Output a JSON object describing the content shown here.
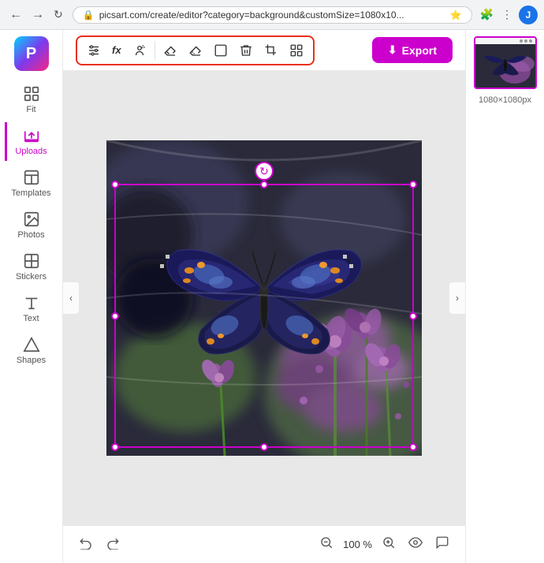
{
  "browser": {
    "url": "picsart.com/create/editor?category=background&customSize=1080x10...",
    "back_label": "←",
    "forward_label": "→",
    "refresh_label": "↻",
    "avatar_label": "J"
  },
  "toolbar": {
    "export_label": "Export",
    "export_icon": "⬇",
    "tools": [
      {
        "id": "adjustments",
        "icon": "⊞",
        "label": "adjustments"
      },
      {
        "id": "fx",
        "icon": "fx",
        "label": "fx"
      },
      {
        "id": "person",
        "icon": "👤",
        "label": "person-cutout"
      }
    ],
    "edit_tools": [
      {
        "id": "eraser",
        "icon": "◻",
        "label": "eraser"
      },
      {
        "id": "eraser2",
        "icon": "⬜",
        "label": "background-eraser"
      },
      {
        "id": "rect",
        "icon": "▭",
        "label": "frame"
      },
      {
        "id": "trash",
        "icon": "🗑",
        "label": "delete"
      },
      {
        "id": "crop",
        "icon": "⛶",
        "label": "crop"
      },
      {
        "id": "more",
        "icon": "•••",
        "label": "more-options"
      }
    ]
  },
  "sidebar": {
    "logo": "P",
    "items": [
      {
        "id": "fit",
        "icon": "fit",
        "label": "Fit"
      },
      {
        "id": "uploads",
        "icon": "uploads",
        "label": "Uploads",
        "active": true
      },
      {
        "id": "templates",
        "icon": "templates",
        "label": "Templates"
      },
      {
        "id": "photos",
        "icon": "photos",
        "label": "Photos"
      },
      {
        "id": "stickers",
        "icon": "stickers",
        "label": "Stickers"
      },
      {
        "id": "text",
        "icon": "text",
        "label": "Text"
      },
      {
        "id": "shapes",
        "icon": "shapes",
        "label": "Shapes"
      }
    ]
  },
  "canvas": {
    "zoom_percent": "100 %",
    "size_label": "1080×1080px"
  },
  "bottom_toolbar": {
    "undo_label": "←",
    "redo_label": "→",
    "zoom_in_label": "⊕",
    "zoom_out_label": "⊖",
    "zoom_value": "100 %",
    "eye_label": "👁",
    "chat_label": "💬"
  }
}
